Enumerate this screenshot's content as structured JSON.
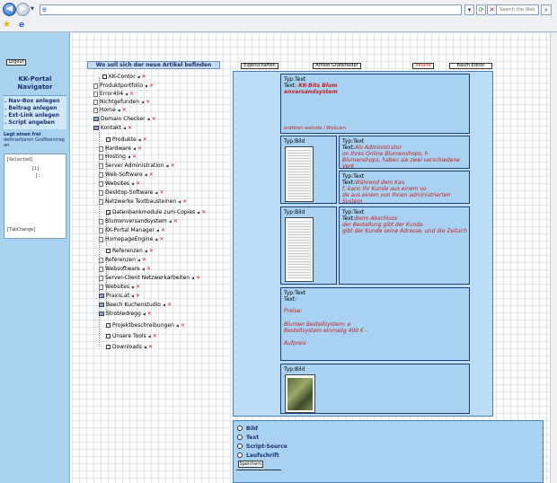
{
  "browser": {
    "search_placeholder": "Search the Web"
  },
  "sidebar": {
    "logout_label": "Logout",
    "title": "KK-Portal Navigator",
    "links": [
      ". Nav-Box anlegen",
      ". Beitrag anlegen",
      ". Ext-Link anlegen",
      ". Script angeben"
    ],
    "free_heading": "Legt einen frei",
    "free_text": "definierbaren Grafikeintrag an.",
    "textarea_lines": [
      "[Selected]",
      "[i]",
      "[:",
      "[TabChange]"
    ]
  },
  "tree": {
    "header": "Wo soll sich der neue Artikel befinden",
    "items": [
      {
        "label": "KK-Contor",
        "icon": "checkbox"
      },
      {
        "label": "Produktportfolio",
        "icon": "doc"
      },
      {
        "label": "Error404",
        "icon": "doc"
      },
      {
        "label": "Nichtgefunden",
        "icon": "doc"
      },
      {
        "label": "Home",
        "icon": "doc"
      },
      {
        "label": "Domain Checker",
        "icon": "pc"
      },
      {
        "label": "Kontakt",
        "icon": "pc"
      },
      {
        "label": "Produkte",
        "icon": "checkbox"
      },
      {
        "label": "Hardware",
        "icon": "doc"
      },
      {
        "label": "Hosting",
        "icon": "doc"
      },
      {
        "label": "Server Administration",
        "icon": "doc"
      },
      {
        "label": "Web-Software",
        "icon": "doc"
      },
      {
        "label": "Websites",
        "icon": "doc"
      },
      {
        "label": "Desktop-Software",
        "icon": "doc"
      },
      {
        "label": "Netzwerke Textbausteinen",
        "icon": "doc"
      },
      {
        "label": "Datenbankmodule zum Copies",
        "icon": "checkbox-on"
      },
      {
        "label": "Blumenversandsystem",
        "icon": "doc"
      },
      {
        "label": "KK-Portal Manager",
        "icon": "doc"
      },
      {
        "label": "HomepageEngine",
        "icon": "doc"
      },
      {
        "label": "Referenzen",
        "icon": "checkbox"
      },
      {
        "label": "Referenzen",
        "icon": "doc"
      },
      {
        "label": "Websoftware",
        "icon": "doc"
      },
      {
        "label": "Server-Client Netzwerkarbeiten",
        "icon": "doc"
      },
      {
        "label": "Websites",
        "icon": "doc"
      },
      {
        "label": "Praxis.at",
        "icon": "pc"
      },
      {
        "label": "Beech Kuchenstudio",
        "icon": "pc"
      },
      {
        "label": "Strobledregg",
        "icon": "pc"
      },
      {
        "label": "Projektbeschreibungen",
        "icon": "checkbox"
      },
      {
        "label": "Unsere Tools",
        "icon": "checkbox"
      },
      {
        "label": "Downloads",
        "icon": "checkbox"
      }
    ]
  },
  "tabs": [
    "Eigenschaften",
    "Artikel Grafikfelder",
    "Inhalte",
    "Baum Editor"
  ],
  "boxes": {
    "b1": {
      "type": "Typ:Text",
      "prefix": "Text:",
      "bold_red": "KK-Bits Blum",
      "red_lines": [
        "enversandsystem"
      ],
      "footer": "erdfeten website / Webcam"
    },
    "b2": {
      "type": "Typ:Bild"
    },
    "b3": {
      "type": "Typ:Text",
      "prefix": "Text:",
      "red_lines": [
        "Als Administrator",
        "on Ihres Online Blumenshops, h",
        "Blumenshops, haben sie zwei verschiedene Verk"
      ]
    },
    "b4": {
      "type": "Typ:Text",
      "prefix": "Text:",
      "red_lines": [
        "Während dem Kau",
        "f, kann Ihr Kunde aus einem vo",
        "de aus einem von Ihnen administrierten System"
      ]
    },
    "b5": {
      "type": "Typ:Bild"
    },
    "b6": {
      "type": "Typ:Text",
      "prefix": "Text:",
      "red_lines": [
        "Beim Abschluss",
        "der Bestellung gibt der Kunde",
        "gibt der Kunde seine Adresse, und die Zeitach"
      ]
    },
    "b7": {
      "type": "Typ:Text",
      "prefix": "Text:",
      "red_lines": [
        "Preise:",
        "",
        "Blumen Bestellsystem: e",
        "Bestellsystem einmalig 400 € -",
        "",
        "Aufpreis"
      ]
    },
    "b8": {
      "type": "Typ:Bild"
    }
  },
  "form": {
    "options": [
      "Bild",
      "Text",
      "Script-Source",
      "Laufschrift"
    ],
    "save_label": "Speichern"
  }
}
